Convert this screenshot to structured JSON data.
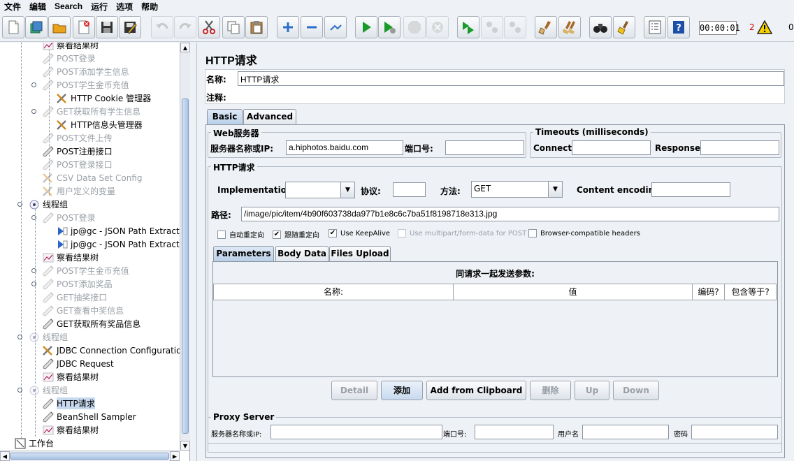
{
  "menu": [
    "文件",
    "编辑",
    "Search",
    "运行",
    "选项",
    "帮助"
  ],
  "toolbar": {
    "icons": [
      "new-icon",
      "templates-icon",
      "open-icon",
      "close-icon",
      "save-icon",
      "save-as-icon",
      "undo-icon",
      "redo-icon",
      "cut-icon",
      "copy-icon",
      "paste-icon",
      "expand-icon",
      "collapse-icon",
      "toggle-icon",
      "start-icon",
      "start-no-pause-icon",
      "stop-icon",
      "shutdown-icon",
      "remote-start-icon",
      "remote-stop-icon",
      "remote-shutdown-icon",
      "clear-icon",
      "clear-all-icon",
      "search-icon",
      "reset-search-icon",
      "function-helper-icon",
      "help-icon"
    ],
    "timer": "00:00:01",
    "error_count": "2",
    "thread_count": "0"
  },
  "tree": {
    "nodes": [
      {
        "label": "察看结果树",
        "dim": false
      },
      {
        "label": "POST登录",
        "dim": true
      },
      {
        "label": "POST添加学生信息",
        "dim": true
      },
      {
        "label": "POST学生金币充值",
        "dim": true
      },
      {
        "label": "HTTP Cookie 管理器",
        "dim": false
      },
      {
        "label": "GET获取所有学生信息",
        "dim": true
      },
      {
        "label": "HTTP信息头管理器",
        "dim": false
      },
      {
        "label": "POST文件上传",
        "dim": true
      },
      {
        "label": "POST注册接口",
        "dim": false
      },
      {
        "label": "POST登录接口",
        "dim": true
      },
      {
        "label": "CSV Data Set Config",
        "dim": true
      },
      {
        "label": "用户定义的变量",
        "dim": true
      },
      {
        "label": "线程组",
        "dim": false
      },
      {
        "label": "POST登录",
        "dim": true
      },
      {
        "label": "jp@gc - JSON Path Extractor",
        "dim": false
      },
      {
        "label": "jp@gc - JSON Path Extractor",
        "dim": false
      },
      {
        "label": "察看结果树",
        "dim": false
      },
      {
        "label": "POST学生金币充值",
        "dim": true
      },
      {
        "label": "POST添加奖品",
        "dim": true
      },
      {
        "label": "GET抽奖接口",
        "dim": true
      },
      {
        "label": "GET查看中奖信息",
        "dim": true
      },
      {
        "label": "GET获取所有奖品信息",
        "dim": false
      },
      {
        "label": "线程组",
        "dim": true
      },
      {
        "label": "JDBC Connection Configuration",
        "dim": false
      },
      {
        "label": "JDBC Request",
        "dim": false
      },
      {
        "label": "察看结果树",
        "dim": false
      },
      {
        "label": "线程组",
        "dim": true
      },
      {
        "label": "HTTP请求",
        "dim": false
      },
      {
        "label": "BeanShell Sampler",
        "dim": false
      },
      {
        "label": "察看结果树",
        "dim": false
      },
      {
        "label": "工作台",
        "dim": false
      }
    ]
  },
  "panel": {
    "title": "HTTP请求",
    "name_label": "名称:",
    "name_value": "HTTP请求",
    "comment_label": "注释:",
    "comment_value": "",
    "tabs": [
      "Basic",
      "Advanced"
    ],
    "web_server": {
      "title": "Web服务器",
      "server_label": "服务器名称或IP:",
      "server_value": "a.hiphotos.baidu.com",
      "port_label": "端口号:",
      "port_value": ""
    },
    "timeouts": {
      "title": "Timeouts (milliseconds)",
      "connect_label": "Connect:",
      "connect_value": "",
      "response_label": "Response:",
      "response_value": ""
    },
    "http_request": {
      "title": "HTTP请求",
      "implementation_label": "Implementation:",
      "implementation_value": "",
      "protocol_label": "协议:",
      "protocol_value": "",
      "method_label": "方法:",
      "method_value": "GET",
      "encoding_label": "Content encoding:",
      "encoding_value": "",
      "path_label": "路径:",
      "path_value": "/image/pic/item/4b90f603738da977b1e8c6c7ba51f8198718e313.jpg"
    },
    "checkboxes": [
      {
        "label": "自动重定向",
        "checked": false,
        "enabled": true
      },
      {
        "label": "跟随重定向",
        "checked": true,
        "enabled": true
      },
      {
        "label": "Use KeepAlive",
        "checked": true,
        "enabled": true
      },
      {
        "label": "Use multipart/form-data for POST",
        "checked": false,
        "enabled": false
      },
      {
        "label": "Browser-compatible headers",
        "checked": false,
        "enabled": true
      }
    ],
    "param_tabs": [
      "Parameters",
      "Body Data",
      "Files Upload"
    ],
    "params_caption": "同请求一起发送参数:",
    "columns": [
      "名称:",
      "值",
      "编码?",
      "包含等于?"
    ],
    "buttons": [
      {
        "label": "Detail",
        "enabled": false
      },
      {
        "label": "添加",
        "enabled": true
      },
      {
        "label": "Add from Clipboard",
        "enabled": true
      },
      {
        "label": "删除",
        "enabled": false
      },
      {
        "label": "Up",
        "enabled": false
      },
      {
        "label": "Down",
        "enabled": false
      }
    ],
    "proxy": {
      "title": "Proxy Server",
      "server_label": "服务器名称或IP:",
      "port_label": "端口号:",
      "user_label": "用户名",
      "password_label": "密码"
    }
  }
}
